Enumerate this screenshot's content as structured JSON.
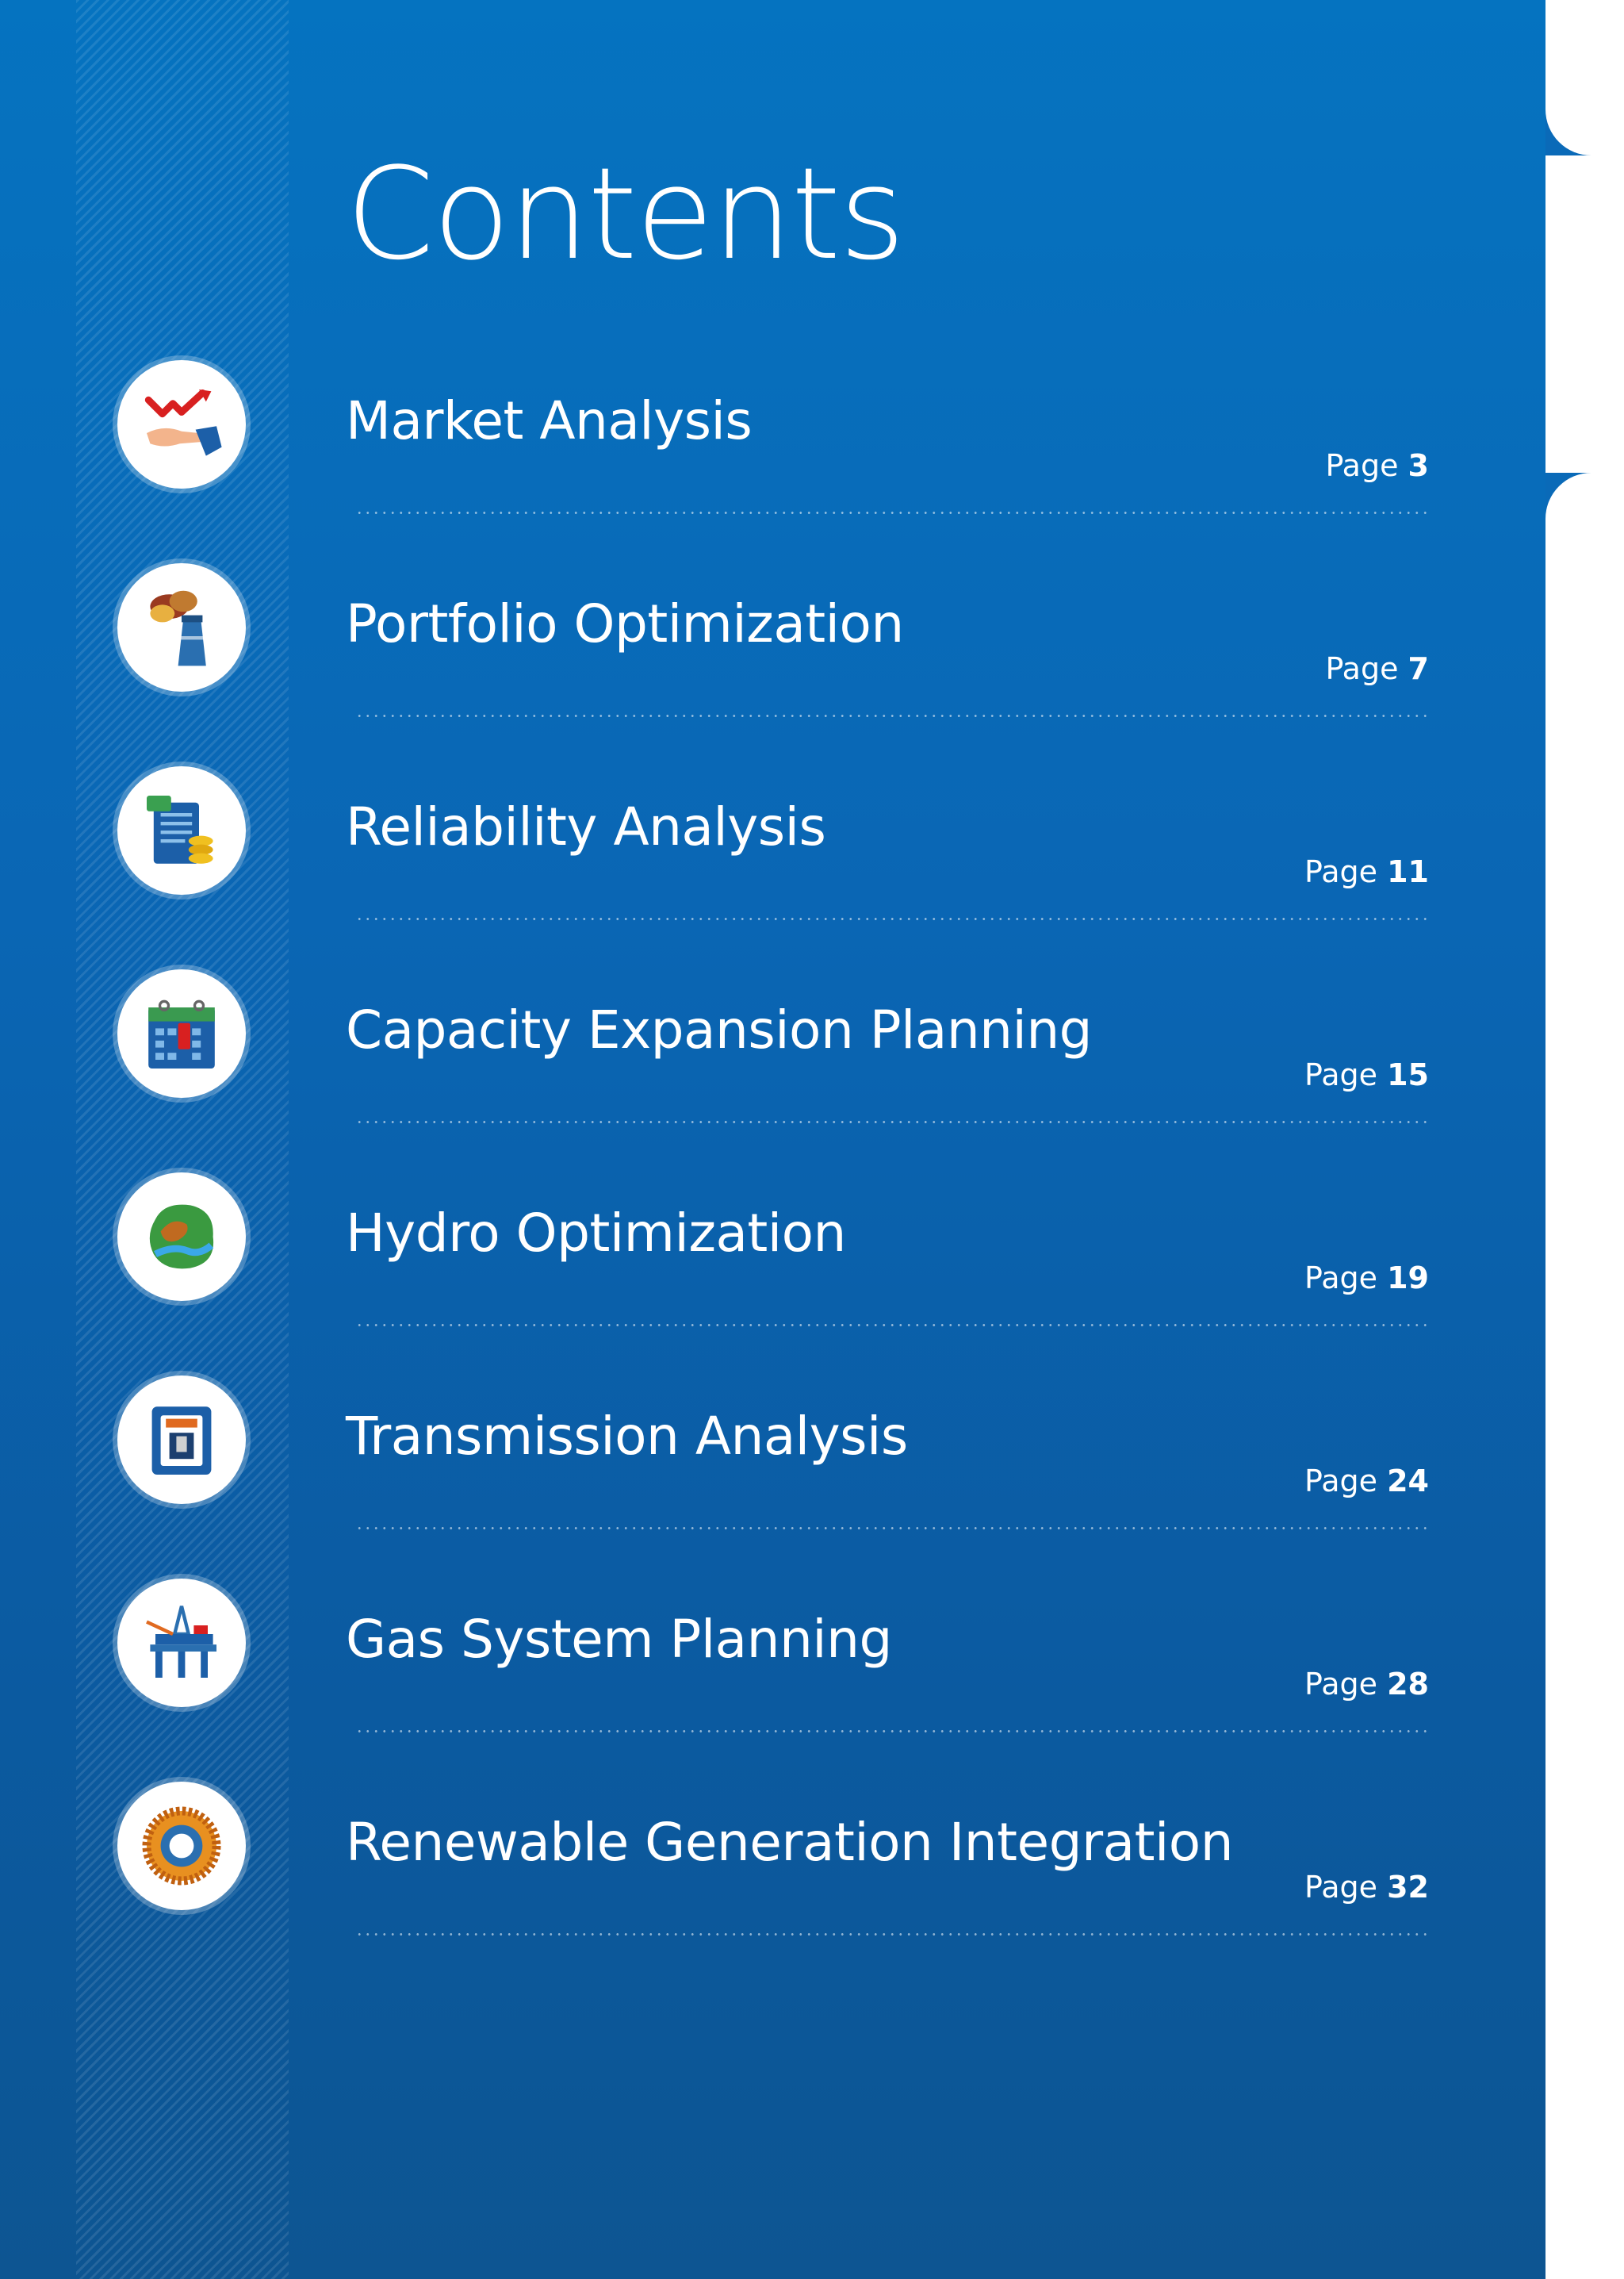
{
  "title": "Contents",
  "entries": [
    {
      "label": "Market Analysis",
      "page_prefix": "Page",
      "page_num": "3",
      "icon": "market-hand-chart-icon"
    },
    {
      "label": "Portfolio Optimization",
      "page_prefix": "Page",
      "page_num": "7",
      "icon": "smokestack-icon"
    },
    {
      "label": "Reliability Analysis",
      "page_prefix": "Page",
      "page_num": "11",
      "icon": "document-coins-icon"
    },
    {
      "label": "Capacity Expansion Planning",
      "page_prefix": "Page",
      "page_num": "15",
      "icon": "calendar-icon"
    },
    {
      "label": "Hydro Optimization",
      "page_prefix": "Page",
      "page_num": "19",
      "icon": "river-map-icon"
    },
    {
      "label": "Transmission Analysis",
      "page_prefix": "Page",
      "page_num": "24",
      "icon": "switch-panel-icon"
    },
    {
      "label": "Gas System Planning",
      "page_prefix": "Page",
      "page_num": "28",
      "icon": "oil-rig-icon"
    },
    {
      "label": "Renewable Generation Integration",
      "page_prefix": "Page",
      "page_num": "32",
      "icon": "solar-ring-icon"
    }
  ],
  "colors": {
    "panel_blue": "#0a66b4",
    "text": "#ffffff"
  }
}
